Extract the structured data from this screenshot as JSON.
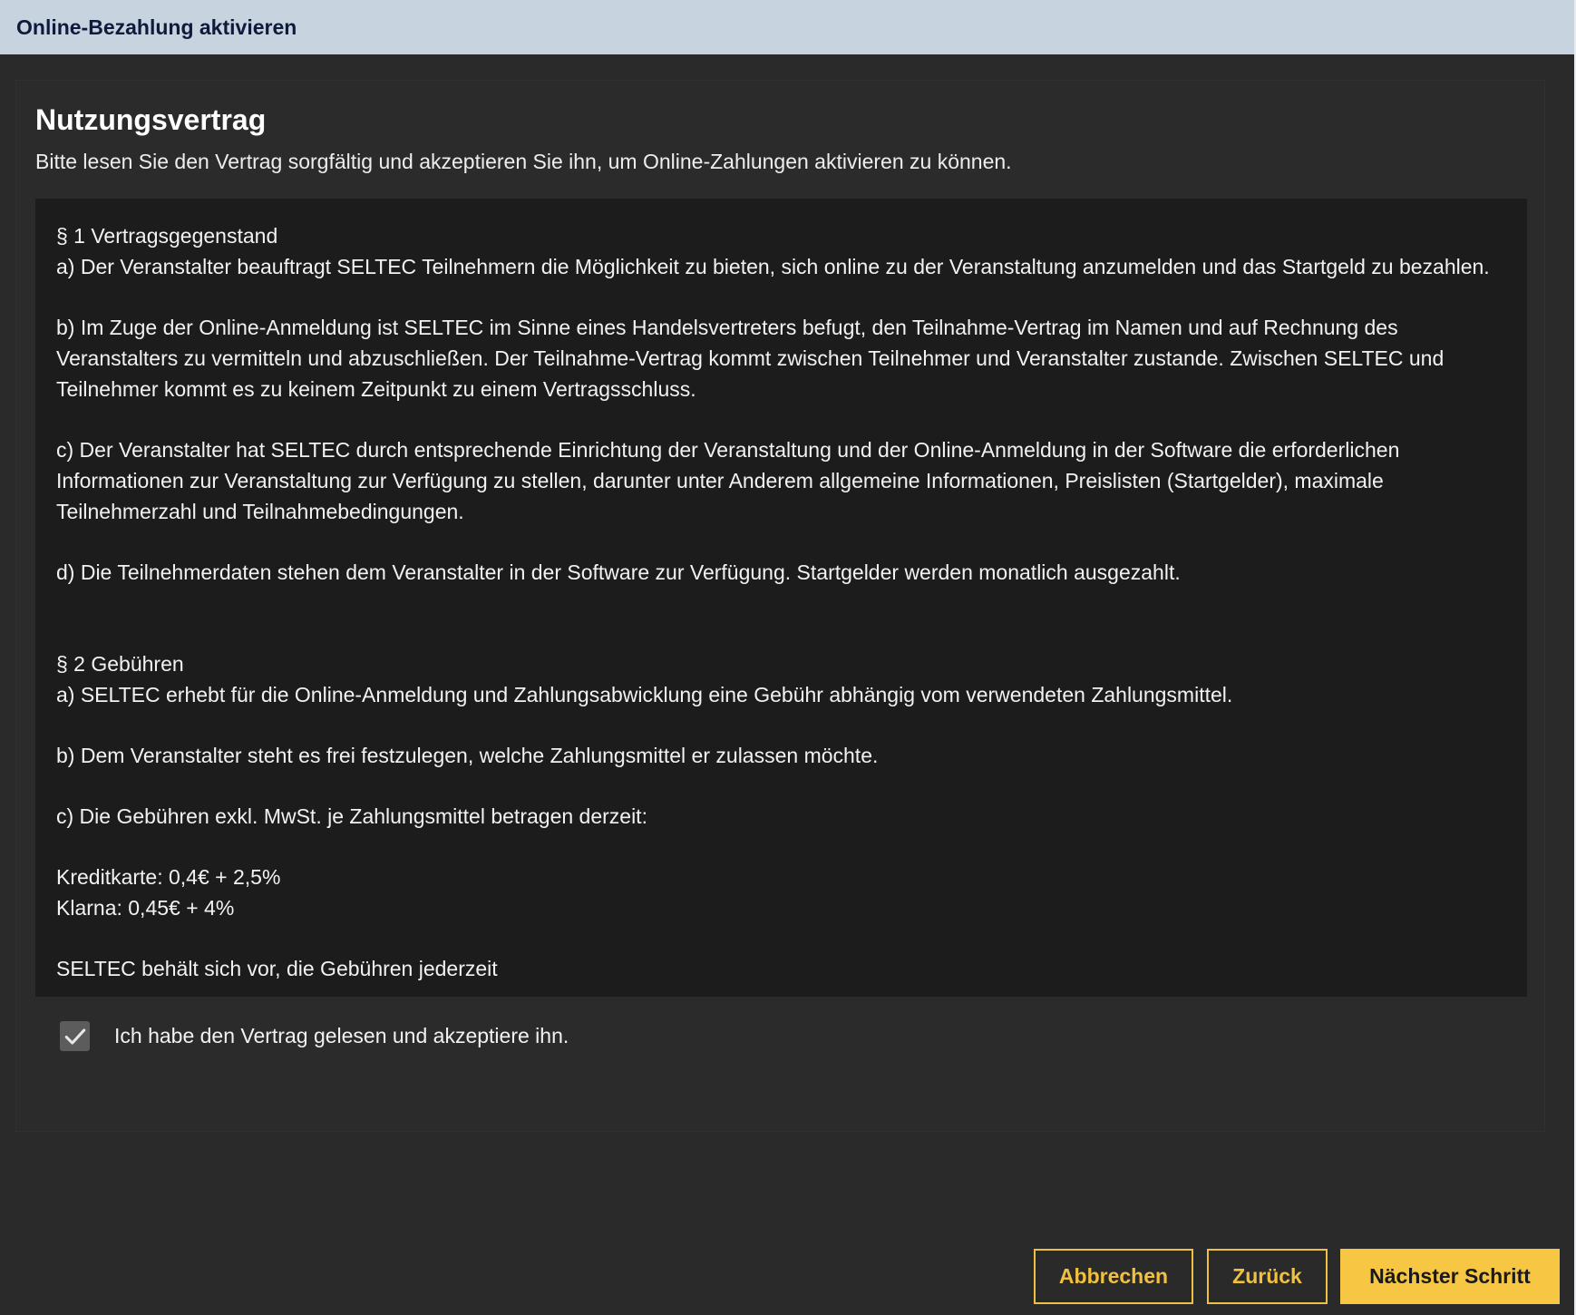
{
  "window": {
    "title": "Online-Bezahlung aktivieren"
  },
  "contract": {
    "heading": "Nutzungsvertrag",
    "subtitle": "Bitte lesen Sie den Vertrag sorgfältig und akzeptieren Sie ihn, um Online-Zahlungen aktivieren zu können.",
    "section1": {
      "title": "§ 1 Vertragsgegenstand",
      "a": "a) Der Veranstalter beauftragt SELTEC Teilnehmern die Möglichkeit zu bieten, sich online zu der Veranstaltung anzumelden und das Startgeld zu bezahlen.",
      "b": "b) Im Zuge der Online-Anmeldung ist SELTEC im Sinne eines Handelsvertreters befugt, den Teilnahme-Vertrag im Namen und auf Rechnung des Veranstalters zu vermitteln und abzuschließen. Der Teilnahme-Vertrag kommt zwischen Teilnehmer und Veranstalter zustande. Zwischen SELTEC und Teilnehmer kommt es zu keinem Zeitpunkt zu einem Vertragsschluss.",
      "c": "c) Der Veranstalter hat SELTEC durch entsprechende Einrichtung der Veranstaltung und der Online-Anmeldung in der Software die erforderlichen Informationen zur Veranstaltung zur Verfügung zu stellen, darunter unter Anderem allgemeine Informationen, Preislisten (Startgelder), maximale Teilnehmerzahl und Teilnahmebedingungen.",
      "d": "d) Die Teilnehmerdaten stehen dem Veranstalter in der Software zur Verfügung. Startgelder werden monatlich ausgezahlt."
    },
    "section2": {
      "title": "§ 2 Gebühren",
      "a": "a) SELTEC erhebt für die Online-Anmeldung und Zahlungsabwicklung eine Gebühr abhängig vom verwendeten Zahlungsmittel.",
      "b": "b) Dem Veranstalter steht es frei festzulegen, welche Zahlungsmittel er zulassen möchte.",
      "c": "c) Die Gebühren exkl. MwSt. je Zahlungsmittel betragen derzeit:",
      "fee_credit_card": "Kreditkarte: 0,4€ + 2,5%",
      "fee_klarna": "Klarna: 0,45€ + 4%",
      "cut_off_line": "SELTEC behält sich vor, die Gebühren jederzeit"
    }
  },
  "acceptance": {
    "checked": true,
    "label": "Ich habe den Vertrag gelesen und akzeptiere ihn."
  },
  "buttons": {
    "cancel": "Abbrechen",
    "back": "Zurück",
    "next": "Nächster Schritt"
  },
  "colors": {
    "titlebar_bg": "#c7d4df",
    "accent": "#f7c744",
    "background": "#2a2a2a",
    "contract_bg": "#1c1c1c"
  }
}
